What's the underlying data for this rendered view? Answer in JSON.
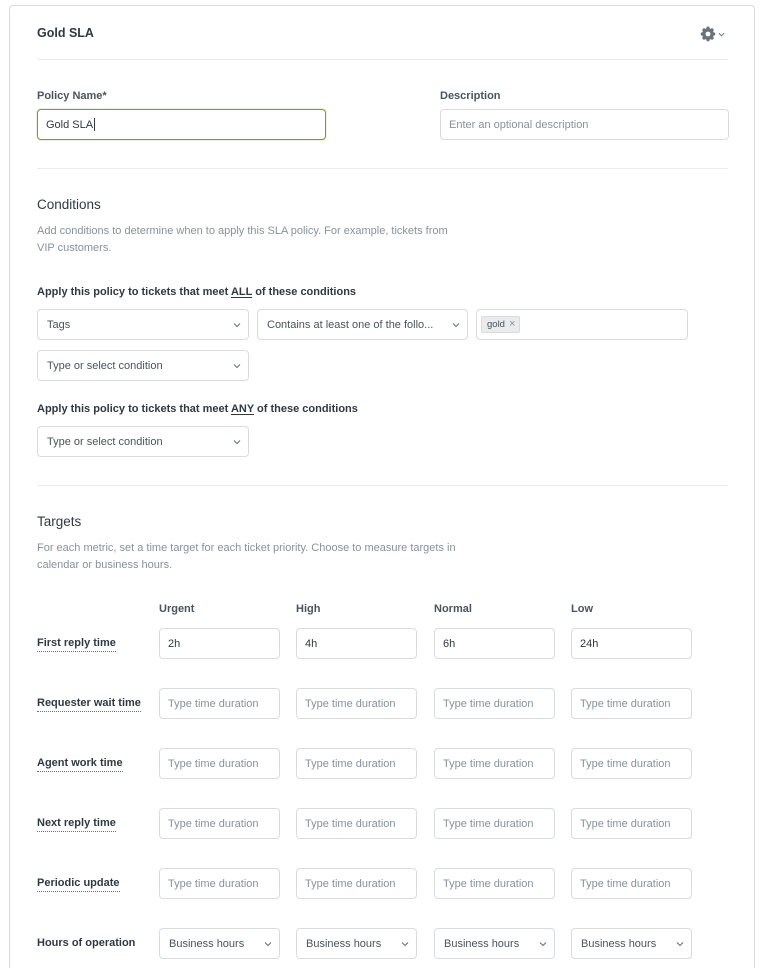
{
  "header": {
    "title": "Gold SLA"
  },
  "policy": {
    "name_label": "Policy Name*",
    "name_value": "Gold SLA",
    "description_label": "Description",
    "description_placeholder": "Enter an optional description"
  },
  "conditions": {
    "title": "Conditions",
    "help": "Add conditions to determine when to apply this SLA policy. For example, tickets from VIP customers.",
    "all_prefix": "Apply this policy to tickets that meet ",
    "all_keyword": "ALL",
    "all_suffix": " of these conditions",
    "all_row": {
      "field": "Tags",
      "operator": "Contains at least one of the follo...",
      "tag": "gold"
    },
    "all_new_placeholder": "Type or select condition",
    "any_prefix": "Apply this policy to tickets that meet ",
    "any_keyword": "ANY",
    "any_suffix": " of these conditions",
    "any_new_placeholder": "Type or select condition"
  },
  "targets": {
    "title": "Targets",
    "help": "For each metric, set a time target for each ticket priority. Choose to measure targets in calendar or business hours.",
    "priorities": [
      "Urgent",
      "High",
      "Normal",
      "Low"
    ],
    "placeholder": "Type time duration",
    "rows": [
      {
        "label": "First reply time",
        "values": [
          "2h",
          "4h",
          "6h",
          "24h"
        ]
      },
      {
        "label": "Requester wait time",
        "values": [
          "",
          "",
          "",
          ""
        ]
      },
      {
        "label": "Agent work time",
        "values": [
          "",
          "",
          "",
          ""
        ]
      },
      {
        "label": "Next reply time",
        "values": [
          "",
          "",
          "",
          ""
        ]
      },
      {
        "label": "Periodic update",
        "values": [
          "",
          "",
          "",
          ""
        ]
      }
    ],
    "hours_label": "Hours of operation",
    "hours_values": [
      "Business hours",
      "Business hours",
      "Business hours",
      "Business hours"
    ]
  },
  "icons": {
    "settings": "gear-icon",
    "dropdown": "chevron-down-icon",
    "remove": "close-icon"
  },
  "colors": {
    "focus_border": "#7d9a2c",
    "tag_bg": "#e9ebed",
    "text": "#2f3941",
    "muted": "#87929d"
  }
}
